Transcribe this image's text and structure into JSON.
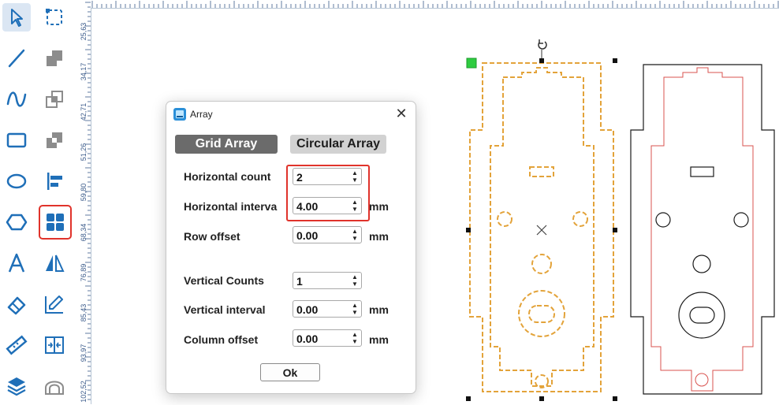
{
  "ruler": {
    "labels": [
      "25,63",
      "34,17",
      "42,71",
      "51,26",
      "59,80",
      "68,34",
      "76,89",
      "85,43",
      "93,97",
      "102,52"
    ]
  },
  "toolbar": {
    "tools": [
      {
        "name": "select-tool",
        "icon": "cursor-arrow-icon",
        "state": "selected"
      },
      {
        "name": "node-edit-tool",
        "icon": "node-edit-icon"
      },
      {
        "name": "line-tool",
        "icon": "line-icon"
      },
      {
        "name": "weld-tool",
        "icon": "weld-icon"
      },
      {
        "name": "curve-tool",
        "icon": "curve-icon"
      },
      {
        "name": "intersect-tool",
        "icon": "intersect-icon"
      },
      {
        "name": "rectangle-tool",
        "icon": "rectangle-icon"
      },
      {
        "name": "subtract-tool",
        "icon": "subtract-icon"
      },
      {
        "name": "ellipse-tool",
        "icon": "ellipse-icon"
      },
      {
        "name": "align-tool",
        "icon": "align-left-icon"
      },
      {
        "name": "polygon-tool",
        "icon": "hexagon-icon"
      },
      {
        "name": "array-tool",
        "icon": "grid-array-icon",
        "state": "highlighted"
      },
      {
        "name": "text-tool",
        "icon": "text-a-icon"
      },
      {
        "name": "mirror-tool",
        "icon": "mirror-icon"
      },
      {
        "name": "eraser-tool",
        "icon": "eraser-icon"
      },
      {
        "name": "edit-tool",
        "icon": "pencil-chart-icon"
      },
      {
        "name": "measure-tool",
        "icon": "ruler-icon"
      },
      {
        "name": "distribute-tool",
        "icon": "distribute-icon"
      },
      {
        "name": "layers-tool",
        "icon": "layers-icon"
      },
      {
        "name": "offset-tool",
        "icon": "offset-path-icon"
      }
    ]
  },
  "dialog": {
    "title": "Array",
    "close_glyph": "✕",
    "tabs": {
      "grid": "Grid Array",
      "circular": "Circular Array"
    },
    "fields": {
      "horizontal_count": {
        "label": "Horizontal count",
        "value": "2"
      },
      "horizontal_interval": {
        "label": "Horizontal interva",
        "value": "4.00",
        "unit": "mm"
      },
      "row_offset": {
        "label": "Row offset",
        "value": "0.00",
        "unit": "mm"
      },
      "vertical_counts": {
        "label": "Vertical Counts",
        "value": "1"
      },
      "vertical_interval": {
        "label": "Vertical interval",
        "value": "0.00",
        "unit": "mm"
      },
      "column_offset": {
        "label": "Column offset",
        "value": "0.00",
        "unit": "mm"
      }
    },
    "ok_label": "Ok"
  },
  "colors": {
    "selected_outline": "#e3a33a",
    "copy_inner": "#d9534f",
    "highlight": "#e0332b",
    "icon_blue": "#1f6fb8"
  }
}
